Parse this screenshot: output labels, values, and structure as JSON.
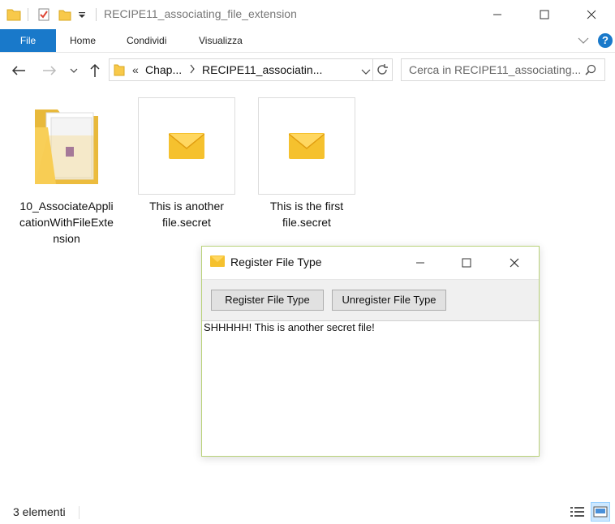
{
  "window": {
    "title": "RECIPE11_associating_file_extension",
    "minimize": "minimize",
    "maximize": "maximize",
    "close": "close"
  },
  "ribbon": {
    "tabs": [
      "File",
      "Home",
      "Condividi",
      "Visualizza"
    ],
    "help": "?"
  },
  "address": {
    "crumb_overflow": "«",
    "crumbs": [
      "Chap...",
      "RECIPE11_associatin..."
    ],
    "search_placeholder": "Cerca in RECIPE11_associating..."
  },
  "items": [
    {
      "label": "10_AssociateApplicationWithFileExtension",
      "type": "folder"
    },
    {
      "label": "This is another file.secret",
      "type": "file"
    },
    {
      "label": "This is the first file.secret",
      "type": "file"
    }
  ],
  "status": {
    "count": "3 elementi"
  },
  "dialog": {
    "title": "Register File Type",
    "register_label": "Register File Type",
    "unregister_label": "Unregister File Type",
    "content": "SHHHHH! This is another secret file!"
  },
  "colors": {
    "accent": "#1979ca",
    "folder": "#f8c94a",
    "envelope": "#f5c12e"
  }
}
